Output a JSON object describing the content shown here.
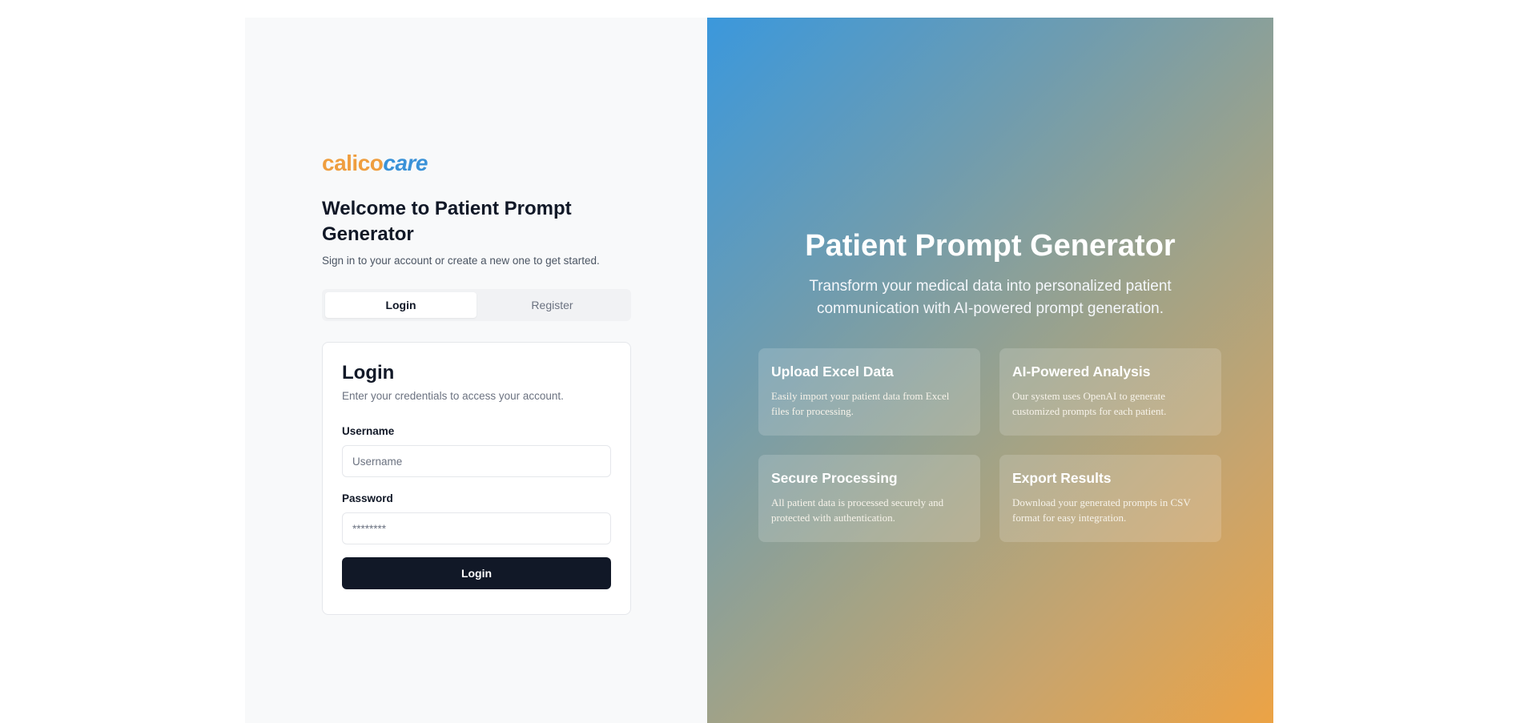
{
  "brand": {
    "part1": "calico",
    "part2": "care"
  },
  "welcome": {
    "title": "Welcome to Patient Prompt Generator",
    "subtitle": "Sign in to your account or create a new one to get started."
  },
  "tabs": [
    {
      "label": "Login",
      "active": true
    },
    {
      "label": "Register",
      "active": false
    }
  ],
  "login_card": {
    "title": "Login",
    "description": "Enter your credentials to access your account.",
    "username_label": "Username",
    "username_placeholder": "Username",
    "password_label": "Password",
    "password_placeholder": "********",
    "submit_label": "Login"
  },
  "hero": {
    "title": "Patient Prompt Generator",
    "subtitle": "Transform your medical data into personalized patient communication with AI-powered prompt generation."
  },
  "features": [
    {
      "title": "Upload Excel Data",
      "description": "Easily import your patient data from Excel files for processing."
    },
    {
      "title": "AI-Powered Analysis",
      "description": "Our system uses OpenAI to generate customized prompts for each patient."
    },
    {
      "title": "Secure Processing",
      "description": "All patient data is processed securely and protected with authentication."
    },
    {
      "title": "Export Results",
      "description": "Download your generated prompts in CSV format for easy integration."
    }
  ],
  "colors": {
    "brand_orange": "#ef9e3f",
    "brand_blue": "#3a92d8",
    "button_dark": "#111827",
    "gradient_start": "#3b98dc",
    "gradient_end": "#eca345"
  }
}
